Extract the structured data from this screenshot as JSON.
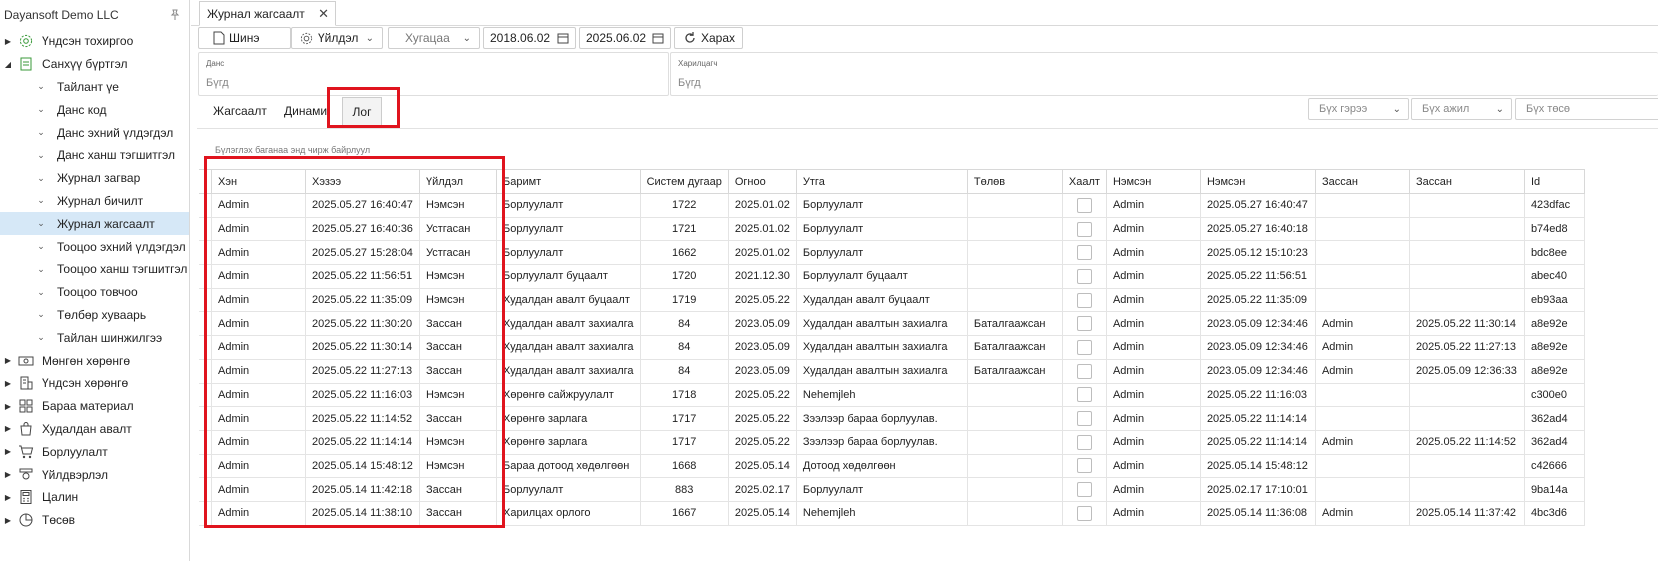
{
  "app": {
    "company": "Dayansoft Demo LLC"
  },
  "sidebar": {
    "items": [
      {
        "label": "Үндсэн тохиргоо",
        "level": "top",
        "expanded": false,
        "icon": "gear-icon"
      },
      {
        "label": "Санхүү бүртгэл",
        "level": "top",
        "expanded": true,
        "icon": "document-icon"
      },
      {
        "label": "Тайлант үе",
        "level": "sub"
      },
      {
        "label": "Данс код",
        "level": "sub"
      },
      {
        "label": "Данс эхний үлдэгдэл",
        "level": "sub"
      },
      {
        "label": "Данс ханш тэгшитгэл",
        "level": "sub"
      },
      {
        "label": "Журнал загвар",
        "level": "sub"
      },
      {
        "label": "Журнал бичилт",
        "level": "sub"
      },
      {
        "label": "Журнал жагсаалт",
        "level": "sub",
        "active": true
      },
      {
        "label": "Тооцоо эхний үлдэгдэл",
        "level": "sub"
      },
      {
        "label": "Тооцоо ханш тэгшитгэл",
        "level": "sub"
      },
      {
        "label": "Тооцоо товчоо",
        "level": "sub"
      },
      {
        "label": "Төлбөр хуваарь",
        "level": "sub"
      },
      {
        "label": "Тайлан шинжилгээ",
        "level": "sub"
      },
      {
        "label": "Мөнгөн хөрөнгө",
        "level": "top",
        "icon": "money-icon"
      },
      {
        "label": "Үндсэн хөрөнгө",
        "level": "top",
        "icon": "building-icon"
      },
      {
        "label": "Бараа материал",
        "level": "top",
        "icon": "box-icon"
      },
      {
        "label": "Худалдан авалт",
        "level": "top",
        "icon": "bag-icon"
      },
      {
        "label": "Борлуулалт",
        "level": "top",
        "icon": "cart-icon"
      },
      {
        "label": "Үйлдвэрлэл",
        "level": "top",
        "icon": "factory-icon"
      },
      {
        "label": "Цалин",
        "level": "top",
        "icon": "calculator-icon"
      },
      {
        "label": "Төсөв",
        "level": "top",
        "icon": "pie-icon"
      }
    ]
  },
  "tab": {
    "title": "Журнал жагсаалт"
  },
  "toolbar": {
    "new_label": "Шинэ",
    "action_label": "Үйлдэл",
    "period_placeholder": "Хугацаа",
    "date_from": "2018.06.02",
    "date_to": "2025.06.02",
    "view_label": "Харах"
  },
  "filters": {
    "account": {
      "label": "Данс",
      "value": "Бүгд"
    },
    "partner": {
      "label": "Харилцагч",
      "value": "Бүгд"
    }
  },
  "subtabs": {
    "summary": "Жагсаалт",
    "dynamic": "Динами",
    "log": "Лог"
  },
  "combos": {
    "contract": "Бүх гэрээ",
    "job": "Бүх ажил",
    "budget": "Бүх төсө"
  },
  "grid": {
    "group_hint": "Бүлэглэх баганаа энд чирж байрлуул",
    "columns": [
      "Хэн",
      "Хэзээ",
      "Үйлдэл",
      "Баримт",
      "Систем дугаар",
      "Огноо",
      "Утга",
      "Төлөв",
      "Хаалт",
      "Нэмсэн",
      "Нэмсэн",
      "Зассан",
      "Зассан",
      "Id"
    ],
    "rows": [
      [
        "Admin",
        "2025.05.27 16:40:47",
        "Нэмсэн",
        "Борлуулалт",
        "1722",
        "2025.01.02",
        "Борлуулалт",
        "",
        "",
        "Admin",
        "2025.05.27 16:40:47",
        "",
        "",
        "423dfac"
      ],
      [
        "Admin",
        "2025.05.27 16:40:36",
        "Устгасан",
        "Борлуулалт",
        "1721",
        "2025.01.02",
        "Борлуулалт",
        "",
        "",
        "Admin",
        "2025.05.27 16:40:18",
        "",
        "",
        "b74ed8"
      ],
      [
        "Admin",
        "2025.05.27 15:28:04",
        "Устгасан",
        "Борлуулалт",
        "1662",
        "2025.01.02",
        "Борлуулалт",
        "",
        "",
        "Admin",
        "2025.05.12 15:10:23",
        "",
        "",
        "bdc8ee"
      ],
      [
        "Admin",
        "2025.05.22 11:56:51",
        "Нэмсэн",
        "Борлуулалт буцаалт",
        "1720",
        "2021.12.30",
        "Борлуулалт буцаалт",
        "",
        "",
        "Admin",
        "2025.05.22 11:56:51",
        "",
        "",
        "abec40"
      ],
      [
        "Admin",
        "2025.05.22 11:35:09",
        "Нэмсэн",
        "Худалдан авалт буцаалт",
        "1719",
        "2025.05.22",
        "Худалдан авалт буцаалт",
        "",
        "",
        "Admin",
        "2025.05.22 11:35:09",
        "",
        "",
        "eb93aa"
      ],
      [
        "Admin",
        "2025.05.22 11:30:20",
        "Зассан",
        "Худалдан авалт захиалга",
        "84",
        "2023.05.09",
        "Худалдан авалтын захиалга",
        "Баталгаажсан",
        "",
        "Admin",
        "2023.05.09 12:34:46",
        "Admin",
        "2025.05.22 11:30:14",
        "a8e92e"
      ],
      [
        "Admin",
        "2025.05.22 11:30:14",
        "Зассан",
        "Худалдан авалт захиалга",
        "84",
        "2023.05.09",
        "Худалдан авалтын захиалга",
        "Баталгаажсан",
        "",
        "Admin",
        "2023.05.09 12:34:46",
        "Admin",
        "2025.05.22 11:27:13",
        "a8e92e"
      ],
      [
        "Admin",
        "2025.05.22 11:27:13",
        "Зассан",
        "Худалдан авалт захиалга",
        "84",
        "2023.05.09",
        "Худалдан авалтын захиалга",
        "Баталгаажсан",
        "",
        "Admin",
        "2023.05.09 12:34:46",
        "Admin",
        "2025.05.09 12:36:33",
        "a8e92e"
      ],
      [
        "Admin",
        "2025.05.22 11:16:03",
        "Нэмсэн",
        "Хөрөнгө сайжруулалт",
        "1718",
        "2025.05.22",
        "Nehemjleh",
        "",
        "",
        "Admin",
        "2025.05.22 11:16:03",
        "",
        "",
        "c300e0"
      ],
      [
        "Admin",
        "2025.05.22 11:14:52",
        "Зассан",
        "Хөрөнгө зарлага",
        "1717",
        "2025.05.22",
        "Зээлээр бараа борлуулав.",
        "",
        "",
        "Admin",
        "2025.05.22 11:14:14",
        "",
        "",
        "362ad4"
      ],
      [
        "Admin",
        "2025.05.22 11:14:14",
        "Нэмсэн",
        "Хөрөнгө зарлага",
        "1717",
        "2025.05.22",
        "Зээлээр бараа борлуулав.",
        "",
        "",
        "Admin",
        "2025.05.22 11:14:14",
        "Admin",
        "2025.05.22 11:14:52",
        "362ad4"
      ],
      [
        "Admin",
        "2025.05.14 15:48:12",
        "Нэмсэн",
        "Бараа дотоод хөдөлгөөн",
        "1668",
        "2025.05.14",
        "Дотоод хөдөлгөөн",
        "",
        "",
        "Admin",
        "2025.05.14 15:48:12",
        "",
        "",
        "c42666"
      ],
      [
        "Admin",
        "2025.05.14 11:42:18",
        "Зассан",
        "Борлуулалт",
        "883",
        "2025.02.17",
        "Борлуулалт",
        "",
        "",
        "Admin",
        "2025.02.17 17:10:01",
        "",
        "",
        "9ba14a"
      ],
      [
        "Admin",
        "2025.05.14 11:38:10",
        "Зассан",
        "Харилцах орлого",
        "1667",
        "2025.05.14",
        "Nehemjleh",
        "",
        "",
        "Admin",
        "2025.05.14 11:36:08",
        "Admin",
        "2025.05.14 11:37:42",
        "4bc3d6"
      ]
    ]
  },
  "colors": {
    "highlight": "#e0141e",
    "active_bg": "#d6e8f7",
    "icon_green": "#3a9a3a"
  }
}
